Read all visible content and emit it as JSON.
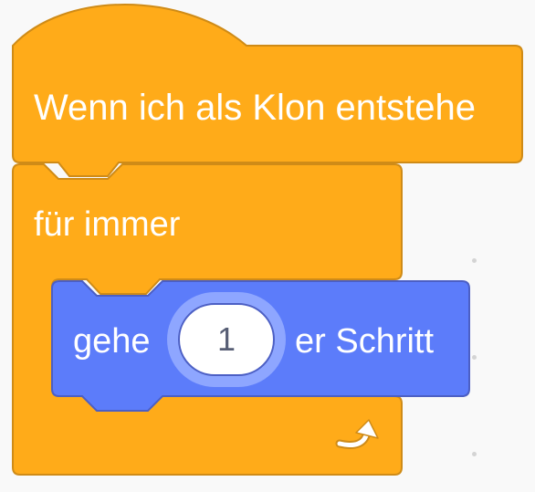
{
  "blocks": {
    "hat": {
      "label": "Wenn ich als Klon entstehe"
    },
    "forever": {
      "label": "für immer"
    },
    "motion": {
      "label_before": "gehe",
      "input_value": "1",
      "label_after": "er Schritt"
    }
  },
  "colors": {
    "control_fill": "#ffab19",
    "control_stroke": "#cf8b17",
    "motion_fill": "#5c7cfa",
    "motion_stroke": "#4c5fc4",
    "input_ring": "#8ea6ff",
    "input_fill": "#ffffff",
    "input_text": "#575e75",
    "background": "#f9f9f9"
  },
  "icons": {
    "loop_arrow": "loop-arrow-icon"
  }
}
